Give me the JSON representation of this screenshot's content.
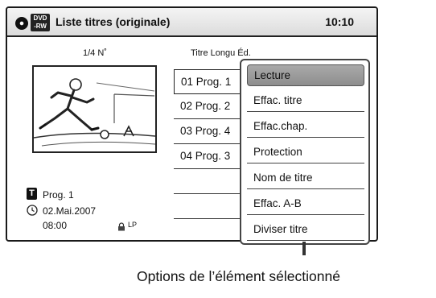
{
  "header": {
    "disc_badge_line1": "DVD",
    "disc_badge_line2": "-RW",
    "title": "Liste titres (originale)",
    "clock": "10:10"
  },
  "info_panel": {
    "thumbnail_counter": "1/4 N˚",
    "title_marker": "T",
    "program_name": "Prog. 1",
    "record_date": "02.Mai.2007",
    "record_time": "08:00",
    "record_mode": "LP"
  },
  "title_list": {
    "header": "Titre Longu Éd.",
    "rows": [
      {
        "label": "01 Prog. 1",
        "selected": true
      },
      {
        "label": "02  Prog. 2",
        "selected": false
      },
      {
        "label": "03  Prog. 4",
        "selected": false
      },
      {
        "label": "04  Prog. 3",
        "selected": false
      },
      {
        "label": "",
        "selected": false
      },
      {
        "label": "",
        "selected": false
      },
      {
        "label": "",
        "selected": false
      }
    ]
  },
  "options_menu": {
    "items": [
      {
        "label": "Lecture",
        "highlighted": true
      },
      {
        "label": "Effac. titre"
      },
      {
        "label": "Effac.chap."
      },
      {
        "label": "Protection"
      },
      {
        "label": "Nom de titre"
      },
      {
        "label": "Effac. A-B"
      },
      {
        "label": "Diviser titre"
      }
    ]
  },
  "callout": {
    "text": "Options de l’élément sélectionné"
  }
}
